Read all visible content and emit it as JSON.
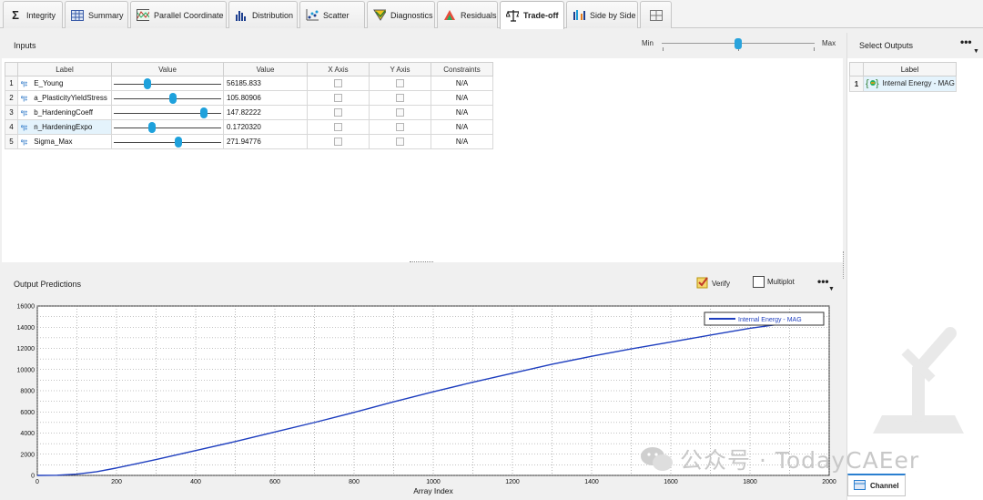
{
  "tabs": [
    {
      "label": "Integrity",
      "icon": "sigma-icon"
    },
    {
      "label": "Summary",
      "icon": "table-icon"
    },
    {
      "label": "Parallel Coordinate",
      "icon": "parallel-coordinate-icon"
    },
    {
      "label": "Distribution",
      "icon": "histogram-icon"
    },
    {
      "label": "Scatter",
      "icon": "scatter-icon"
    },
    {
      "label": "Diagnostics",
      "icon": "diagnostics-icon"
    },
    {
      "label": "Residuals",
      "icon": "residuals-icon"
    },
    {
      "label": "Trade-off",
      "icon": "balance-scale-icon",
      "active": true
    },
    {
      "label": "Side by Side",
      "icon": "side-by-side-icon"
    },
    {
      "label": "",
      "icon": "grid-layout-icon"
    }
  ],
  "inputs": {
    "title": "Inputs",
    "min_label": "Min",
    "max_label": "Max",
    "columns": [
      "Label",
      "Value",
      "Value",
      "X Axis",
      "Y Axis",
      "Constraints"
    ],
    "rows": [
      {
        "num": "1",
        "label": "E_Young",
        "slider": 0.31,
        "value": "56185.833",
        "constraint": "N/A",
        "selected": false
      },
      {
        "num": "2",
        "label": "a_PlasticityYieldStress",
        "slider": 0.55,
        "value": "105.80906",
        "constraint": "N/A",
        "selected": false
      },
      {
        "num": "3",
        "label": "b_HardeningCoeff",
        "slider": 0.83,
        "value": "147.82222",
        "constraint": "N/A",
        "selected": false
      },
      {
        "num": "4",
        "label": "n_HardeningExpo",
        "slider": 0.35,
        "value": "0.1720320",
        "constraint": "N/A",
        "selected": true
      },
      {
        "num": "5",
        "label": "Sigma_Max",
        "slider": 0.6,
        "value": "271.94776",
        "constraint": "N/A",
        "selected": false
      }
    ]
  },
  "outputs_panel": {
    "title": "Output Predictions",
    "verify_label": "Verify",
    "multiplot_label": "Multiplot",
    "more": "•••"
  },
  "select_outputs": {
    "title": "Select Outputs",
    "more": "•••",
    "column": "Label",
    "rows": [
      {
        "num": "1",
        "label": "Internal Energy - MAG"
      }
    ]
  },
  "bottom_tab": {
    "label": "Channel"
  },
  "watermark": "公众号 · TodayCAEer",
  "colors": {
    "accent": "#1ea1dc",
    "series": "#1f3fbf"
  },
  "chart_data": {
    "type": "line",
    "xlabel": "Array Index",
    "ylabel": "",
    "xlim": [
      0,
      2000
    ],
    "ylim": [
      0,
      16000
    ],
    "xticks": [
      "0",
      "200",
      "400",
      "600",
      "800",
      "1000",
      "1200",
      "1400",
      "1600",
      "1800",
      "2000"
    ],
    "yticks": [
      "0",
      "2000",
      "4000",
      "6000",
      "8000",
      "10000",
      "12000",
      "14000",
      "16000"
    ],
    "legend_position": "top-right",
    "series": [
      {
        "name": "Internal Energy - MAG",
        "x": [
          0,
          50,
          100,
          150,
          200,
          300,
          400,
          500,
          600,
          700,
          800,
          900,
          1000,
          1100,
          1200,
          1300,
          1400,
          1500,
          1600,
          1700,
          1800,
          1900
        ],
        "y": [
          0,
          20,
          120,
          350,
          700,
          1500,
          2350,
          3200,
          4100,
          5000,
          5950,
          6950,
          7900,
          8800,
          9650,
          10500,
          11250,
          11950,
          12600,
          13250,
          13900,
          14400
        ]
      }
    ]
  }
}
